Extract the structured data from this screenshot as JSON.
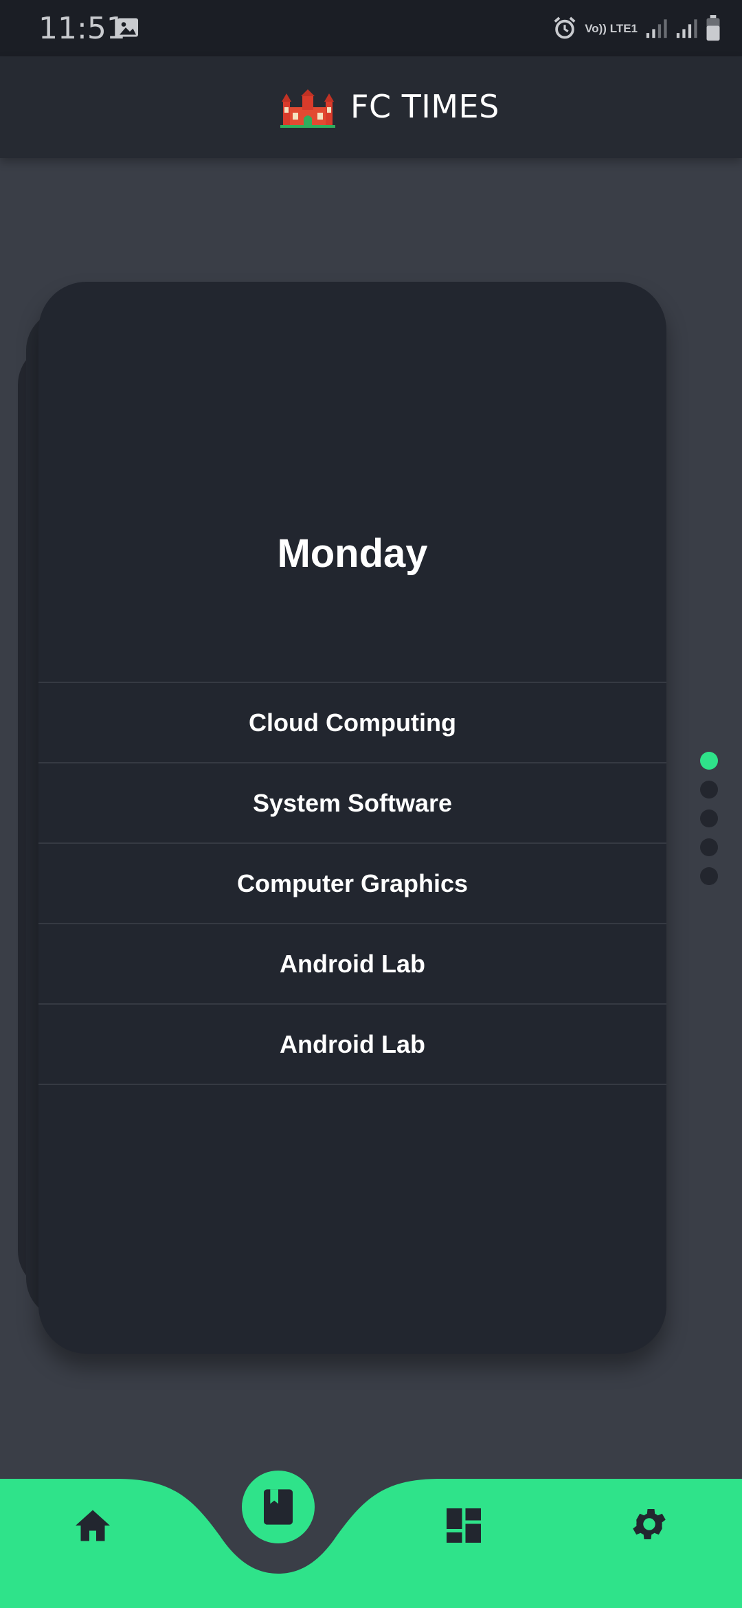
{
  "status_bar": {
    "time": "11:51",
    "network_label": "Vo)) LTE1"
  },
  "app_bar": {
    "title": "FC TIMES",
    "logo_icon": "college-building-logo"
  },
  "timetable": {
    "day": "Monday",
    "subjects": [
      "Cloud Computing",
      "System Software",
      "Computer Graphics",
      "Android Lab",
      "Android Lab"
    ],
    "page_count": 5,
    "active_page": 0
  },
  "bottom_nav": {
    "items": [
      {
        "icon": "home-icon"
      },
      {
        "icon": "book-icon",
        "active": true
      },
      {
        "icon": "dashboard-icon"
      },
      {
        "icon": "settings-icon"
      }
    ]
  },
  "colors": {
    "accent": "#2fe38a",
    "background": "#3a3e47",
    "card": "#22262f",
    "app_bar": "#262a32"
  }
}
